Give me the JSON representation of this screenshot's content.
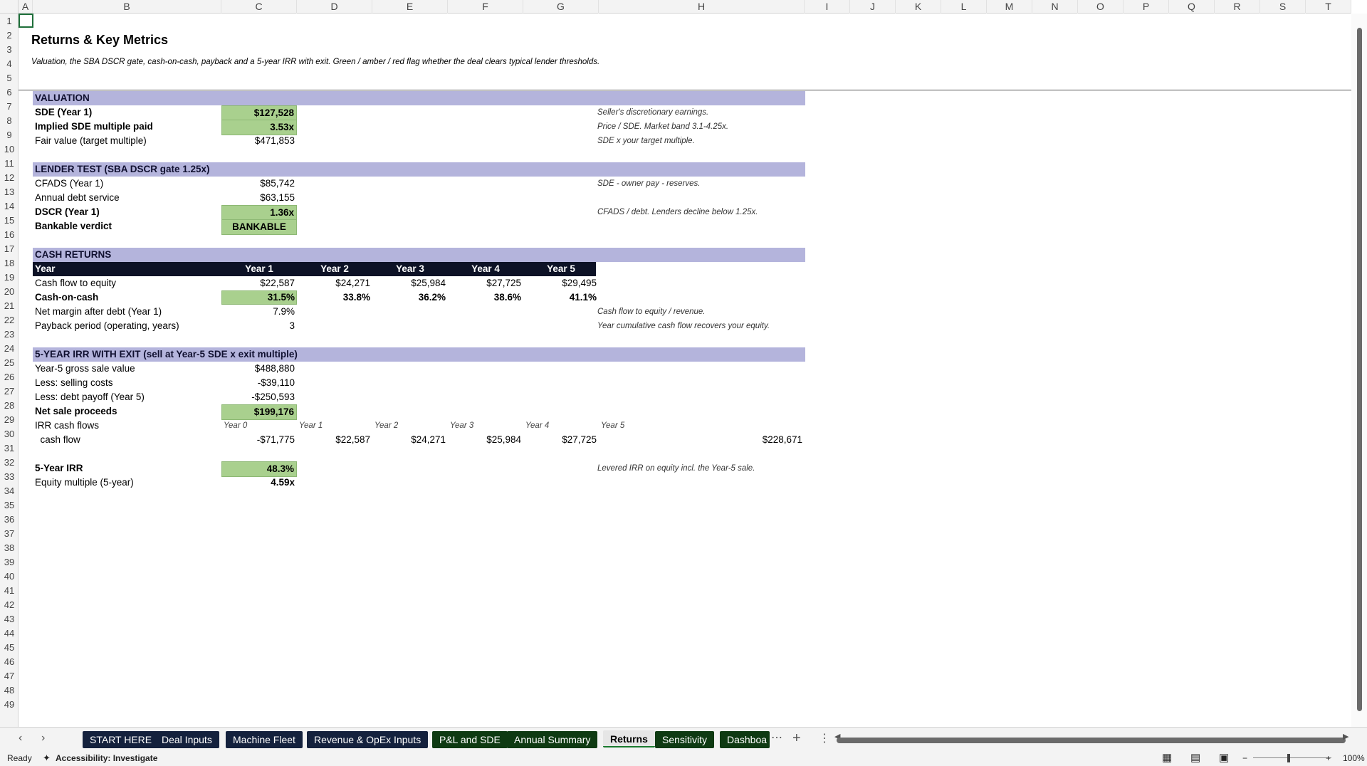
{
  "columns": [
    "A",
    "B",
    "C",
    "D",
    "E",
    "F",
    "G",
    "H",
    "I",
    "J",
    "K",
    "L",
    "M",
    "N",
    "O",
    "P",
    "Q",
    "R",
    "S",
    "T"
  ],
  "rows": [
    "1",
    "2",
    "3",
    "4",
    "5",
    "6",
    "7",
    "8",
    "9",
    "10",
    "11",
    "12",
    "13",
    "14",
    "15",
    "16",
    "17",
    "18",
    "19",
    "20",
    "21",
    "22",
    "23",
    "24",
    "25",
    "26",
    "27",
    "28",
    "29",
    "30",
    "31",
    "32",
    "33",
    "34",
    "35",
    "36",
    "37",
    "38",
    "39",
    "40",
    "41",
    "42",
    "43",
    "44",
    "45",
    "46",
    "47",
    "48",
    "49"
  ],
  "sheet": {
    "title": "Returns & Key Metrics",
    "subtitle": "Valuation, the SBA DSCR gate, cash-on-cash, payback and a 5-year IRR with exit. Green / amber / red flag whether the deal clears typical lender thresholds.",
    "valuation": {
      "header": "VALUATION",
      "sde_label": "SDE (Year 1)",
      "sde_value": "$127,528",
      "sde_note": "Seller's discretionary earnings.",
      "multiple_label": "Implied SDE multiple paid",
      "multiple_value": "3.53x",
      "multiple_note": "Price / SDE. Market band 3.1-4.25x.",
      "fair_label": "Fair value (target multiple)",
      "fair_value": "$471,853",
      "fair_note": "SDE x your target multiple."
    },
    "lender": {
      "header": "LENDER TEST  (SBA DSCR gate 1.25x)",
      "cfads_label": "CFADS (Year 1)",
      "cfads_value": "$85,742",
      "cfads_note": "SDE - owner pay - reserves.",
      "debt_label": "Annual debt service",
      "debt_value": "$63,155",
      "dscr_label": "DSCR (Year 1)",
      "dscr_value": "1.36x",
      "dscr_note": "CFADS / debt. Lenders decline below 1.25x.",
      "verdict_label": "Bankable verdict",
      "verdict_value": "BANKABLE"
    },
    "cash": {
      "header": "CASH RETURNS",
      "year_label": "Year",
      "years": [
        "Year 1",
        "Year 2",
        "Year 3",
        "Year 4",
        "Year 5"
      ],
      "cf_label": "Cash flow to equity",
      "cf": [
        "$22,587",
        "$24,271",
        "$25,984",
        "$27,725",
        "$29,495"
      ],
      "coc_label": "Cash-on-cash",
      "coc": [
        "31.5%",
        "33.8%",
        "36.2%",
        "38.6%",
        "41.1%"
      ],
      "margin_label": "Net margin after debt (Year 1)",
      "margin_value": "7.9%",
      "margin_note": "Cash flow to equity / revenue.",
      "payback_label": "Payback period (operating, years)",
      "payback_value": "3",
      "payback_note": "Year cumulative cash flow recovers your equity."
    },
    "irr": {
      "header": "5-YEAR IRR WITH EXIT (sell at Year-5 SDE x exit multiple)",
      "gross_label": "Year-5 gross sale value",
      "gross_value": "$488,880",
      "selling_label": "Less: selling costs",
      "selling_value": "-$39,110",
      "payoff_label": "Less: debt payoff (Year 5)",
      "payoff_value": "-$250,593",
      "net_label": "Net sale proceeds",
      "net_value": "$199,176",
      "flows_label": "IRR cash flows",
      "flow_years": [
        "Year 0",
        "Year 1",
        "Year 2",
        "Year 3",
        "Year 4",
        "Year 5"
      ],
      "cashflow_label": "  cash flow",
      "cashflows": [
        "-$71,775",
        "$22,587",
        "$24,271",
        "$25,984",
        "$27,725",
        "$228,671"
      ],
      "irr_label": "5-Year IRR",
      "irr_value": "48.3%",
      "irr_note": "Levered IRR on equity incl. the Year-5 sale.",
      "eqm_label": "Equity multiple (5-year)",
      "eqm_value": "4.59x"
    }
  },
  "tabs": [
    "START HERE",
    "Deal Inputs",
    "Machine Fleet",
    "Revenue & OpEx Inputs",
    "P&L and SDE",
    "Annual Summary",
    "Returns",
    "Sensitivity",
    "Dashboa"
  ],
  "status": {
    "ready": "Ready",
    "accessibility": "Accessibility: Investigate",
    "zoom": "100%"
  },
  "colors": {
    "section": "#b4b4dc",
    "green": "#a9d08e",
    "dark_header": "#0d1226"
  }
}
